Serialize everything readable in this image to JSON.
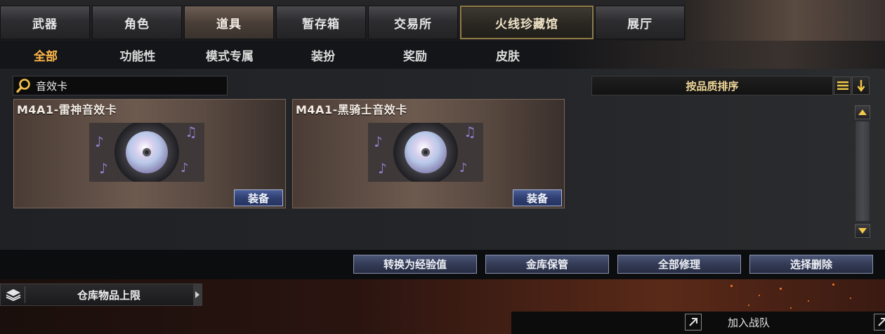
{
  "tabs": [
    {
      "label": "武器"
    },
    {
      "label": "角色"
    },
    {
      "label": "道具"
    },
    {
      "label": "暂存箱"
    },
    {
      "label": "交易所"
    },
    {
      "label": "火线珍藏馆"
    },
    {
      "label": "展厅"
    }
  ],
  "active_tab": "道具",
  "subtabs": [
    {
      "label": "全部"
    },
    {
      "label": "功能性"
    },
    {
      "label": "模式专属"
    },
    {
      "label": "装扮"
    },
    {
      "label": "奖励"
    },
    {
      "label": "皮肤"
    }
  ],
  "active_subtab": "全部",
  "search": {
    "value": "音效卡",
    "icon": "search-icon"
  },
  "sort": {
    "label": "按品质排序",
    "icons": [
      "list-icon",
      "arrow-down-icon"
    ]
  },
  "items": [
    {
      "title": "M4A1-雷神音效卡",
      "action": "装备",
      "icon": "music-disc-icon"
    },
    {
      "title": "M4A1-黑骑士音效卡",
      "action": "装备",
      "icon": "music-disc-icon"
    }
  ],
  "actions": [
    {
      "label": "转换为经验值"
    },
    {
      "label": "金库保管"
    },
    {
      "label": "全部修理"
    },
    {
      "label": "选择删除"
    }
  ],
  "storage": {
    "label": "仓库物品上限",
    "icon": "layers-icon"
  },
  "squad": {
    "label": "加入战队",
    "icon": "expand-icon"
  },
  "colors": {
    "accent": "#ffb84a",
    "button_blue": "#333b56",
    "gold_text": "#f0d79a"
  }
}
